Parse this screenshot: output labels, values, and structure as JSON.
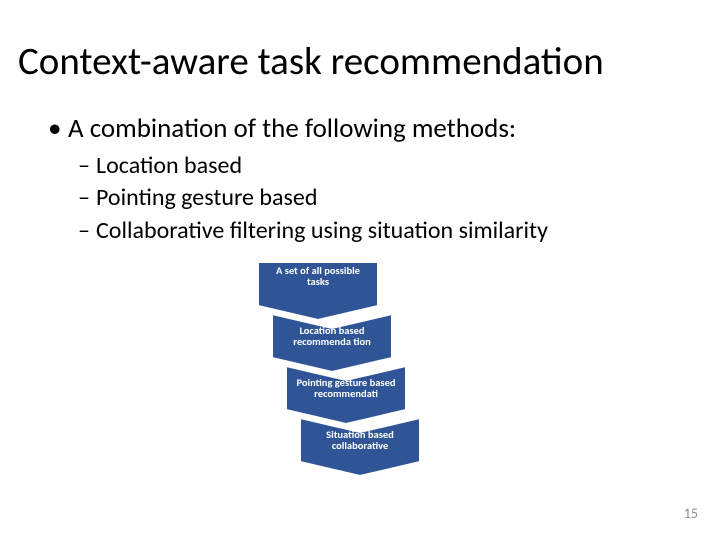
{
  "title": "Context-aware task recommendation",
  "bullet": "A combination of the following methods:",
  "subitems": [
    "Location based",
    "Pointing gesture based",
    "Collaborative filtering using situation similarity"
  ],
  "flow": {
    "fill": "#2f5597",
    "stroke": "#ffffff",
    "items": [
      "A set of all possible tasks",
      "Location based recommenda tion",
      "Pointing gesture based recommendati",
      "Situation based collaborative"
    ]
  },
  "page_number": "15"
}
